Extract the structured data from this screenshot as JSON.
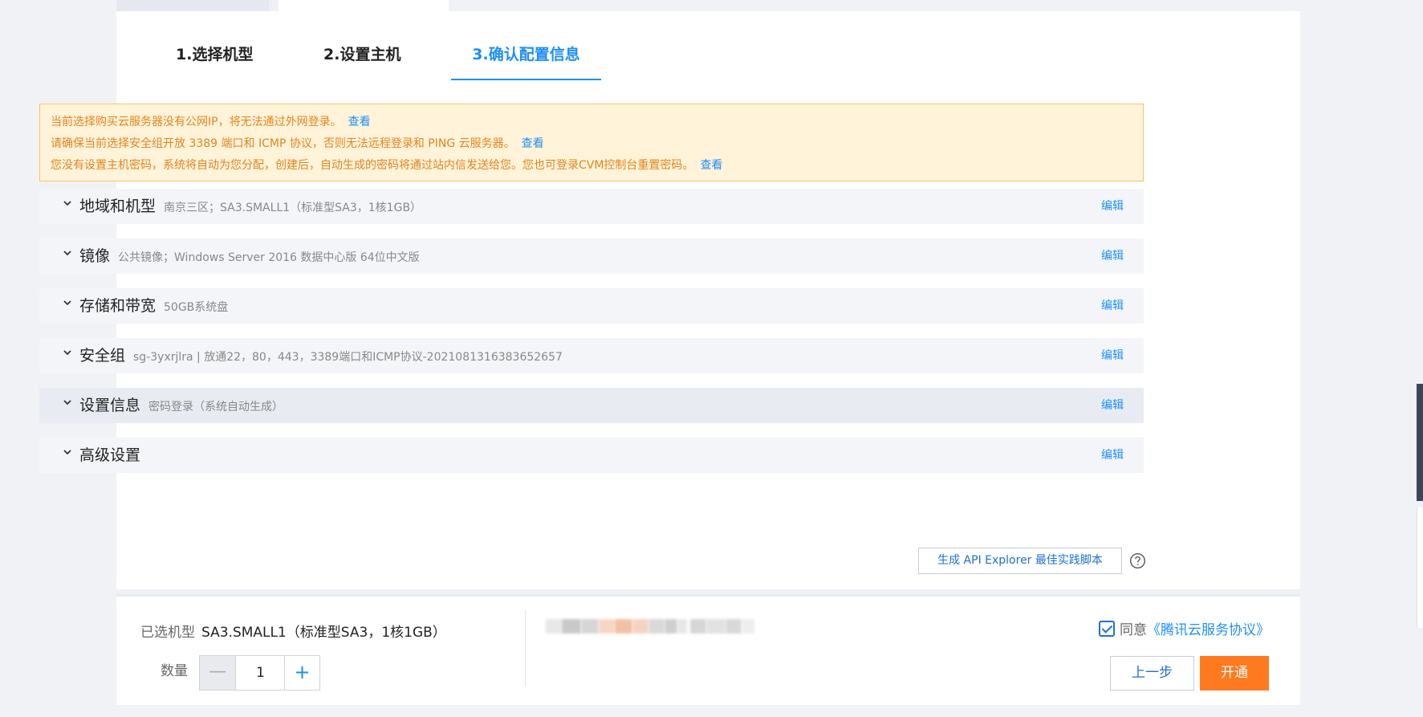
{
  "steps": [
    {
      "label": "1.选择机型"
    },
    {
      "label": "2.设置主机"
    },
    {
      "label": "3.确认配置信息",
      "active": true
    }
  ],
  "notice": {
    "lines": [
      {
        "text": "当前选择购买云服务器没有公网IP，将无法通过外网登录。",
        "link": "查看"
      },
      {
        "text": "请确保当前选择安全组开放 3389 端口和 ICMP 协议，否则无法远程登录和 PING 云服务器。",
        "link": "查看"
      },
      {
        "text": "您没有设置主机密码，系统将自动为您分配，创建后，自动生成的密码将通过站内信发送给您。您也可登录CVM控制台重置密码。",
        "link": "查看"
      }
    ]
  },
  "sections": [
    {
      "title": "地域和机型",
      "summary": "南京三区；SA3.SMALL1（标准型SA3，1核1GB）",
      "edit": "编辑"
    },
    {
      "title": "镜像",
      "summary": "公共镜像；Windows Server 2016 数据中心版 64位中文版",
      "edit": "编辑"
    },
    {
      "title": "存储和带宽",
      "summary": "50GB系统盘",
      "edit": "编辑"
    },
    {
      "title": "安全组",
      "summary": "sg-3yxrjlra | 放通22，80，443，3389端口和ICMP协议-2021081316383652657",
      "edit": "编辑"
    },
    {
      "title": "设置信息",
      "summary": "密码登录（系统自动生成）",
      "edit": "编辑"
    },
    {
      "title": "高级设置",
      "summary": "",
      "edit": "编辑"
    }
  ],
  "api_explorer": {
    "label": "生成 API Explorer 最佳实践脚本"
  },
  "bottom": {
    "selected_label": "已选机型",
    "selected_value": "SA3.SMALL1（标准型SA3，1核1GB）",
    "quantity_label": "数量",
    "quantity_value": "1",
    "minus_glyph": "—",
    "plus_glyph": "+",
    "agree_text": "同意",
    "agree_link": "《腾讯云服务协议》",
    "prev_label": "上一步",
    "open_label": "开通"
  },
  "colors": {
    "accent": "#1d8ff7",
    "warning_text": "#e4841e",
    "warning_bg": "#fff3d9",
    "primary_action": "#ff7a1e"
  }
}
